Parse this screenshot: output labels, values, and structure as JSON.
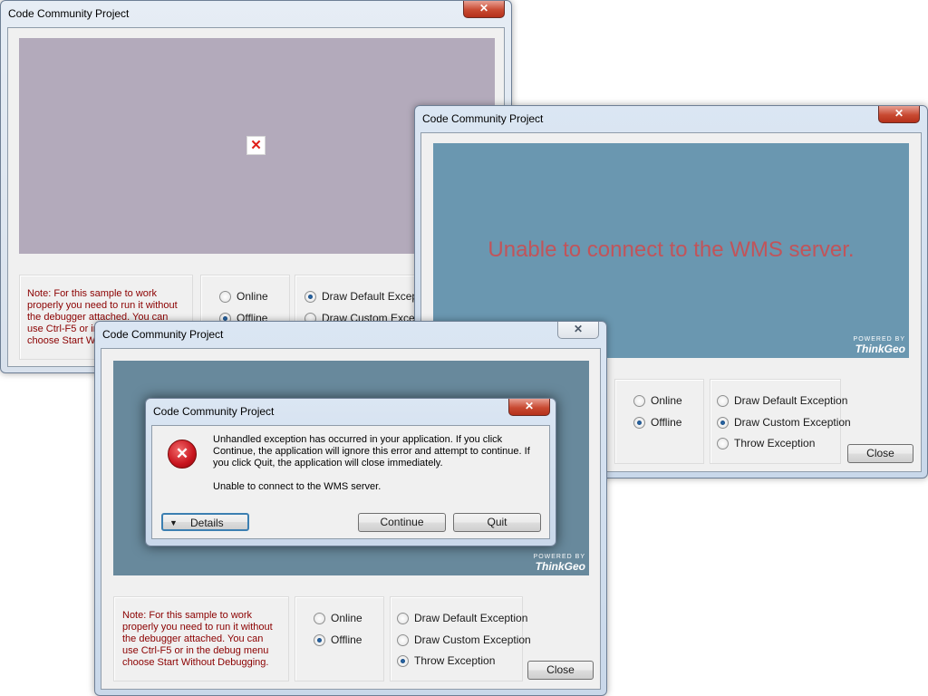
{
  "window1": {
    "title": "Code Community Project",
    "close_glyph": "✕",
    "broken_image_glyph": "✕",
    "note": "Note: For this sample to work properly you need to run it without the debugger attached.  You can use Ctrl-F5 or in the debug menu choose Start Without Debugging.",
    "radios": {
      "online": "Online",
      "offline": "Offline",
      "default_ex": "Draw Default Exception",
      "custom_ex": "Draw Custom Exception"
    }
  },
  "window2": {
    "title": "Code Community Project",
    "close_glyph": "✕",
    "map_message": "Unable to connect to the WMS server.",
    "powered_by": "POWERED BY",
    "brand": "ThinkGeo",
    "radios": {
      "online": "Online",
      "offline": "Offline",
      "default_ex": "Draw Default Exception",
      "custom_ex": "Draw Custom Exception",
      "throw_ex": "Throw Exception"
    },
    "close_label": "Close"
  },
  "window3": {
    "title": "Code Community Project",
    "close_glyph": "✕",
    "powered_by": "POWERED BY",
    "brand": "ThinkGeo",
    "note": "Note: For this sample to work properly you need to run it without the debugger attached.  You can use Ctrl-F5 or in the debug menu choose Start Without Debugging.",
    "radios": {
      "online": "Online",
      "offline": "Offline",
      "default_ex": "Draw Default Exception",
      "custom_ex": "Draw Custom Exception",
      "throw_ex": "Throw Exception"
    },
    "close_label": "Close"
  },
  "dialog": {
    "title": "Code Community Project",
    "close_glyph": "✕",
    "message": "Unhandled exception has occurred in your application. If you click Continue, the application will ignore this error and attempt to continue. If you click Quit, the application will close immediately.",
    "detail": "Unable to connect to the WMS server.",
    "details_label": "Details",
    "continue_label": "Continue",
    "quit_label": "Quit",
    "error_glyph": "✕"
  },
  "colors": {
    "map_grey": "#b3aabb",
    "map_blue": "#6a97b0",
    "map_blue_dark": "#68899c",
    "error_text": "#c1545a",
    "error_icon": "#c8141e"
  }
}
